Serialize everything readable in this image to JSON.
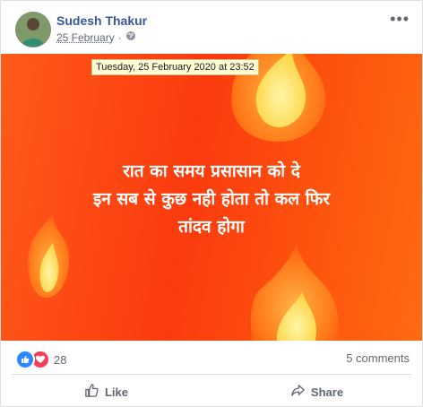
{
  "post": {
    "author": "Sudesh Thakur",
    "date": "25 February",
    "date_separator": "·",
    "tooltip": "Tuesday, 25 February 2020 at 23:52",
    "more_icon": "more-dots-icon",
    "privacy_icon": "globe-icon",
    "text_lines": [
      "रात का समय प्रसासान को दे",
      "इन सब से कुछ नही होता तो कल फिर",
      "तांदव होगा"
    ]
  },
  "engagement": {
    "reaction_count": "28",
    "comments": "5 comments",
    "reaction_icons": [
      "like-reaction-icon",
      "love-reaction-icon"
    ]
  },
  "actions": {
    "like": "Like",
    "share": "Share"
  },
  "colors": {
    "image_bg": "#fb3b0d",
    "link": "#385898",
    "like_blue": "#2d88ff",
    "love_red": "#f33e58"
  }
}
